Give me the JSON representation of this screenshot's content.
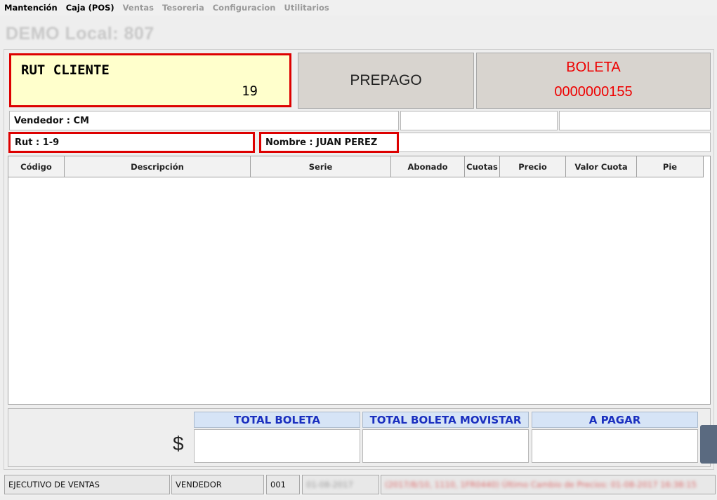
{
  "menu": {
    "items": [
      {
        "label": "Mantención",
        "enabled": true
      },
      {
        "label": "Caja (POS)",
        "enabled": true
      },
      {
        "label": "Ventas",
        "enabled": false
      },
      {
        "label": "Tesoreria",
        "enabled": false
      },
      {
        "label": "Configuracion",
        "enabled": false
      },
      {
        "label": "Utilitarios",
        "enabled": false
      }
    ]
  },
  "header": {
    "title": "DEMO Local: 807"
  },
  "rut_cliente": {
    "label": "RUT CLIENTE",
    "value": "19"
  },
  "prepago": {
    "label": "PREPAGO"
  },
  "boleta": {
    "label": "BOLETA",
    "number": "0000000155"
  },
  "fields": {
    "vendedor": "Vendedor : CM",
    "rut": "Rut : 1-9",
    "nombre": "Nombre : JUAN PEREZ"
  },
  "table": {
    "columns": [
      "Código",
      "Descripción",
      "Serie",
      "Abonado",
      "Cuotas",
      "Precio",
      "Valor Cuota",
      "Pie"
    ],
    "rows": []
  },
  "totals": {
    "currency_symbol": "$",
    "total_boleta": "TOTAL BOLETA",
    "total_boleta_movistar": "TOTAL BOLETA MOVISTAR",
    "a_pagar": "A PAGAR"
  },
  "status": {
    "role": "EJECUTIVO DE VENTAS",
    "user": "VENDEDOR",
    "code": "001",
    "date": "01-08-2017",
    "message": "(2017/8/10, 1110, 1FR0440) Último Cambio de Precios: 01-08-2017 16:38:15"
  },
  "colors": {
    "alert_red": "#dd0000",
    "boleta_text": "#ee0000",
    "totals_header_text": "#1a2fbf",
    "totals_header_bg": "#d6e4f6",
    "rut_bg": "#ffffcc"
  }
}
